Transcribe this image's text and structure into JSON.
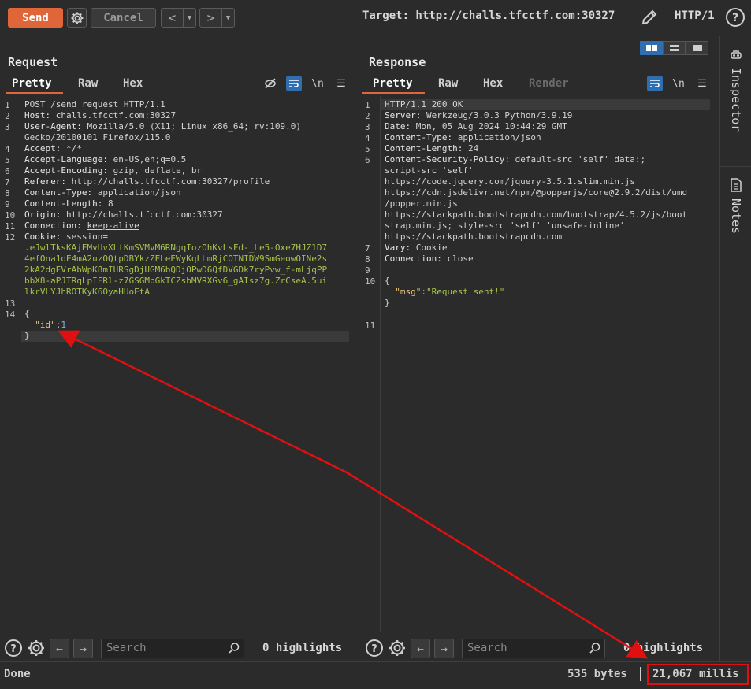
{
  "toolbar": {
    "send_label": "Send",
    "cancel_label": "Cancel",
    "target": "Target: http://challs.tfcctf.com:30327",
    "http_version": "HTTP/1"
  },
  "request": {
    "title": "Request",
    "tabs": [
      "Pretty",
      "Raw",
      "Hex"
    ],
    "active_tab": "Pretty",
    "lines": [
      {
        "n": "1",
        "text": "POST /send_request HTTP/1.1"
      },
      {
        "n": "2",
        "key": "Host: ",
        "val": "challs.tfcctf.com:30327"
      },
      {
        "n": "3",
        "key": "User-Agent: ",
        "val": "Mozilla/5.0 (X11; Linux x86_64; rv:109.0)"
      },
      {
        "n": "",
        "text": "Gecko/20100101 Firefox/115.0"
      },
      {
        "n": "4",
        "key": "Accept: ",
        "val": "*/*"
      },
      {
        "n": "5",
        "key": "Accept-Language: ",
        "val": "en-US,en;q=0.5"
      },
      {
        "n": "6",
        "key": "Accept-Encoding: ",
        "val": "gzip, deflate, br"
      },
      {
        "n": "7",
        "key": "Referer: ",
        "val": "http://challs.tfcctf.com:30327/profile"
      },
      {
        "n": "8",
        "key": "Content-Type: ",
        "val": "application/json"
      },
      {
        "n": "9",
        "key": "Content-Length: ",
        "val": "8"
      },
      {
        "n": "10",
        "key": "Origin: ",
        "val": "http://challs.tfcctf.com:30327"
      },
      {
        "n": "11",
        "key": "Connection: ",
        "val": "keep-alive"
      },
      {
        "n": "12",
        "key": "Cookie: ",
        "val": "session="
      },
      {
        "n": "",
        "cookie": ".eJwlTksKAjEMvUvXLtKmSVMvM6RNgqIozOhKvLsFd-_Le5-Oxe7HJZ1D7"
      },
      {
        "n": "",
        "cookie": "4efOna1dE4mA2uzOQtpDBYkzZELeEWyKqLLmRjCOTNIDW9SmGeowOINe2s"
      },
      {
        "n": "",
        "cookie": "2kA2dgEVrAbWpK8mIURSgDjUGM6bQDjOPwD6QfDVGDk7ryPvw_f-mLjqPP"
      },
      {
        "n": "",
        "cookie": "bbX8-aPJTRqLpIFRl-z7GSGMpGkTCZsbMVRXGv6_gAIsz7g.ZrCseA.5ui"
      },
      {
        "n": "",
        "cookie": "lkrVLYJhROTKyK6OyaHUoEtA"
      },
      {
        "n": "13",
        "text": ""
      },
      {
        "n": "14",
        "text": "{"
      },
      {
        "n": "",
        "json_key": "\"id\"",
        "json_num": "1"
      },
      {
        "n": "",
        "text": "}"
      }
    ]
  },
  "response": {
    "title": "Response",
    "tabs": [
      "Pretty",
      "Raw",
      "Hex",
      "Render"
    ],
    "active_tab": "Pretty",
    "lines": [
      {
        "n": "1",
        "text": "HTTP/1.1 200 OK"
      },
      {
        "n": "2",
        "key": "Server: ",
        "val": "Werkzeug/3.0.3 Python/3.9.19"
      },
      {
        "n": "3",
        "key": "Date: ",
        "val": "Mon, 05 Aug 2024 10:44:29 GMT"
      },
      {
        "n": "4",
        "key": "Content-Type: ",
        "val": "application/json"
      },
      {
        "n": "5",
        "key": "Content-Length: ",
        "val": "24"
      },
      {
        "n": "6",
        "key": "Content-Security-Policy: ",
        "val": "default-src 'self' data:;"
      },
      {
        "n": "",
        "text": "script-src 'self'"
      },
      {
        "n": "",
        "text": "https://code.jquery.com/jquery-3.5.1.slim.min.js"
      },
      {
        "n": "",
        "text": "https://cdn.jsdelivr.net/npm/@popperjs/core@2.9.2/dist/umd"
      },
      {
        "n": "",
        "text": "/popper.min.js"
      },
      {
        "n": "",
        "text": "https://stackpath.bootstrapcdn.com/bootstrap/4.5.2/js/boot"
      },
      {
        "n": "",
        "text": "strap.min.js; style-src 'self' 'unsafe-inline'"
      },
      {
        "n": "",
        "text": "https://stackpath.bootstrapcdn.com"
      },
      {
        "n": "7",
        "key": "Vary: ",
        "val": "Cookie"
      },
      {
        "n": "8",
        "key": "Connection: ",
        "val": "close"
      },
      {
        "n": "9",
        "text": ""
      },
      {
        "n": "10",
        "text": "{"
      },
      {
        "n": "",
        "json_key": "\"msg\"",
        "json_str": "\"Request sent!\""
      },
      {
        "n": "",
        "text": "}"
      },
      {
        "n": "",
        "text": ""
      },
      {
        "n": "11",
        "text": ""
      }
    ]
  },
  "search": {
    "placeholder": "Search",
    "req_highlights": "0 highlights",
    "resp_highlights": "0 highlights"
  },
  "sidebar": {
    "inspector": "Inspector",
    "notes": "Notes"
  },
  "status": {
    "text": "Done",
    "bytes": "535 bytes",
    "millis": "21,067 millis"
  },
  "colors": {
    "accent": "#e0663a",
    "annotation": "#e01010",
    "active_tool": "#2f6fb0"
  }
}
